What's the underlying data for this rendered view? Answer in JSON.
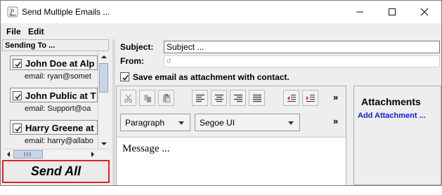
{
  "window": {
    "title": "Send Multiple Emails ..."
  },
  "menu": {
    "file": "File",
    "edit": "Edit"
  },
  "left": {
    "header": "Sending To ...",
    "contacts": [
      {
        "name": "John Doe at Alp",
        "email": "email: ryan@somet",
        "checked": true
      },
      {
        "name": "John Public at T",
        "email": "email: Support@oa",
        "checked": true
      },
      {
        "name": "Harry Greene at",
        "email": "email: harry@allabo",
        "checked": true
      }
    ],
    "send_all": "Send All"
  },
  "compose": {
    "subject_label": "Subject:",
    "subject_value": "Subject ...",
    "from_label": "From:",
    "from_value": "d",
    "save_label": "Save email as attachment with contact.",
    "save_checked": true,
    "paragraph_combo": "Paragraph",
    "font_combo": "Segoe UI",
    "more_label": "»",
    "message": "Message ..."
  },
  "attachments": {
    "title": "Attachments",
    "add_link": "Add Attachment ..."
  },
  "colors": {
    "send_all_border": "#e0202a",
    "link": "#1a1ad4"
  }
}
